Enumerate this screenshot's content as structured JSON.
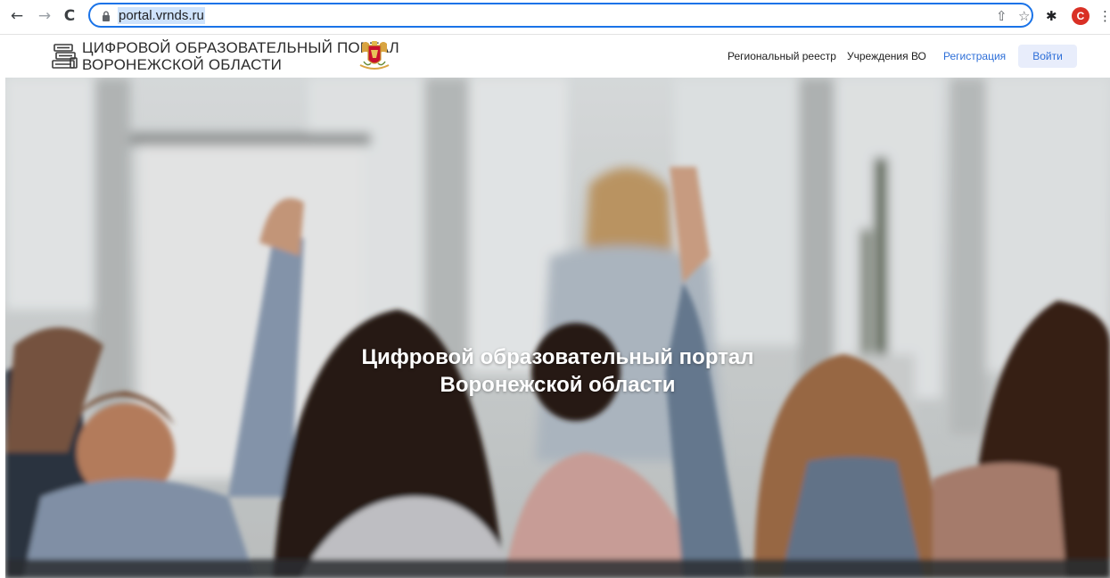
{
  "browser": {
    "back_icon": "←",
    "forward_icon": "→",
    "reload_icon": "C",
    "url": "portal.vrnds.ru",
    "share_icon": "⇧",
    "bookmark_icon": "☆",
    "extensions_icon": "✱",
    "profile_initial": "C",
    "menu_icon": "⋮"
  },
  "header": {
    "logo_line1": "ЦИФРОВОЙ ОБРАЗОВАТЕЛЬНЫЙ ПОРТАЛ",
    "logo_line2": "ВОРОНЕЖСКОЙ ОБЛАСТИ",
    "nav": {
      "registry": "Региональный реестр",
      "institutions": "Учреждения ВО",
      "register": "Регистрация",
      "login": "Войти"
    }
  },
  "hero": {
    "title_line1": "Цифровой образовательный портал",
    "title_line2": "Воронежской области"
  },
  "colors": {
    "accent": "#2e6fd8",
    "login_bg": "#e8edfb",
    "address_focus": "#1a73e8",
    "profile": "#d93025"
  }
}
